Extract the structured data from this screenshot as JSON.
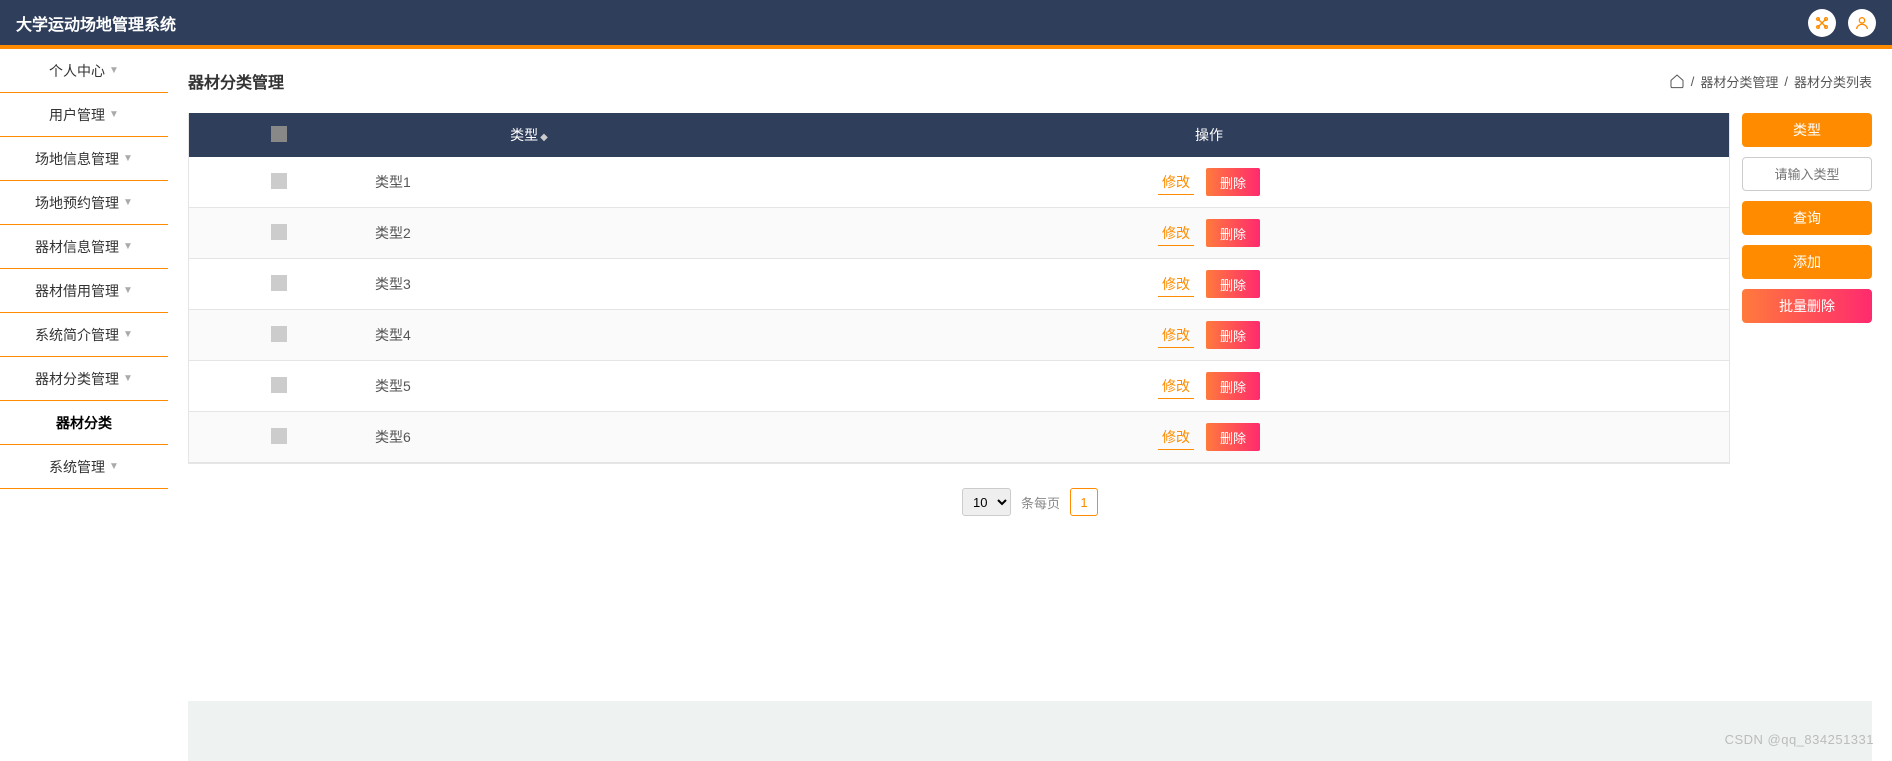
{
  "header": {
    "title": "大学运动场地管理系统"
  },
  "sidebar": {
    "items": [
      {
        "label": "个人中心",
        "caret": true
      },
      {
        "label": "用户管理",
        "caret": true
      },
      {
        "label": "场地信息管理",
        "caret": true
      },
      {
        "label": "场地预约管理",
        "caret": true
      },
      {
        "label": "器材信息管理",
        "caret": true
      },
      {
        "label": "器材借用管理",
        "caret": true
      },
      {
        "label": "系统简介管理",
        "caret": true
      },
      {
        "label": "器材分类管理",
        "caret": true
      },
      {
        "label": "器材分类",
        "caret": false,
        "active": true
      },
      {
        "label": "系统管理",
        "caret": true
      }
    ]
  },
  "page": {
    "title": "器材分类管理",
    "breadcrumb": {
      "sep1": " / ",
      "a": "器材分类管理",
      "sep2": " / ",
      "b": "器材分类列表"
    }
  },
  "table": {
    "headers": {
      "type": "类型",
      "op": "操作"
    },
    "rows": [
      {
        "type": "类型1"
      },
      {
        "type": "类型2"
      },
      {
        "type": "类型3"
      },
      {
        "type": "类型4"
      },
      {
        "type": "类型5"
      },
      {
        "type": "类型6"
      }
    ],
    "edit_label": "修改",
    "delete_label": "删除"
  },
  "actions": {
    "type_label": "类型",
    "input_placeholder": "请输入类型",
    "search": "查询",
    "add": "添加",
    "batch_delete": "批量删除"
  },
  "pager": {
    "page_size": "10",
    "label": "条每页",
    "current": "1"
  },
  "watermark": "CSDN @qq_834251331"
}
